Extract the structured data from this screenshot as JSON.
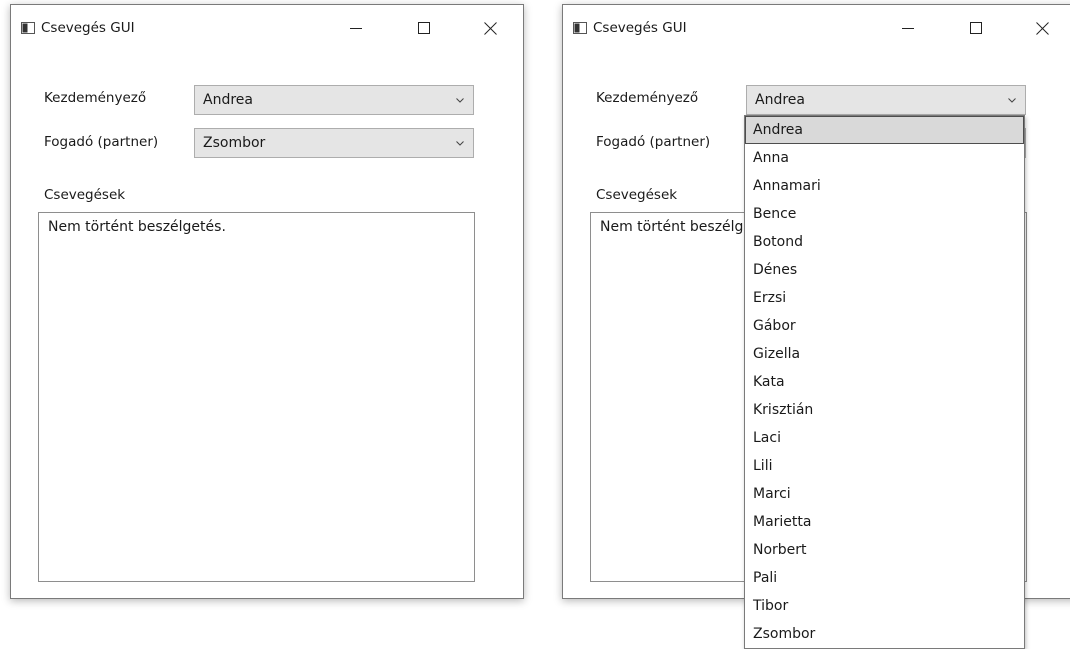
{
  "window_left": {
    "title": "Csevegés GUI",
    "initiator_label": "Kezdeményező",
    "initiator_value": "Andrea",
    "partner_label": "Fogadó (partner)",
    "partner_value": "Zsombor",
    "chats_label": "Csevegések",
    "chat_text": "Nem történt beszélgetés."
  },
  "window_right": {
    "title": "Csevegés GUI",
    "initiator_label": "Kezdeményező",
    "initiator_value": "Andrea",
    "partner_label": "Fogadó (partner)",
    "chats_label": "Csevegések",
    "chat_text": "Nem történt beszélgetés."
  },
  "dropdown": {
    "selected": "Andrea",
    "options": [
      "Andrea",
      "Anna",
      "Annamari",
      "Bence",
      "Botond",
      "Dénes",
      "Erzsi",
      "Gábor",
      "Gizella",
      "Kata",
      "Krisztián",
      "Laci",
      "Lili",
      "Marci",
      "Marietta",
      "Norbert",
      "Pali",
      "Tibor",
      "Zsombor"
    ]
  },
  "icons": {
    "app": "window-app-icon",
    "minimize": "minimize-icon",
    "maximize": "maximize-icon",
    "close": "close-icon",
    "combo_arrow": "chevron-down-icon"
  }
}
